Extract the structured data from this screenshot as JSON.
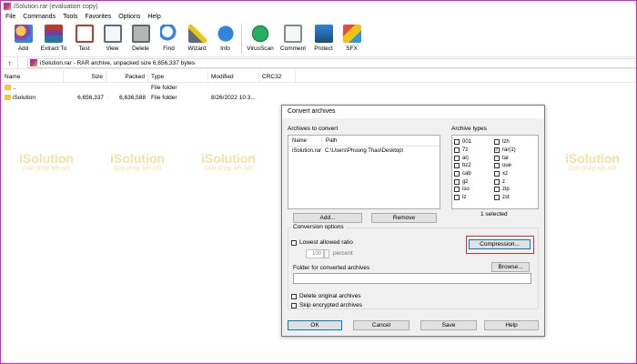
{
  "window": {
    "title": "iSolution.rar (evaluation copy)"
  },
  "menu": [
    "File",
    "Commands",
    "Tools",
    "Favorites",
    "Options",
    "Help"
  ],
  "toolbar": {
    "add": "Add",
    "extract": "Extract To",
    "test": "Test",
    "view": "View",
    "delete": "Delete",
    "find": "Find",
    "wizard": "Wizard",
    "info": "Info",
    "virusscan": "VirusScan",
    "comment": "Comment",
    "protect": "Protect",
    "sfx": "SFX"
  },
  "address": {
    "up": "↑",
    "path": "iSolution.rar - RAR archive, unpacked size 6,656,337 bytes"
  },
  "filelist": {
    "headers": {
      "name": "Name",
      "size": "Size",
      "packed": "Packed",
      "type": "Type",
      "modified": "Modified",
      "crc": "CRC32"
    },
    "rows": [
      {
        "name": "..",
        "size": "",
        "packed": "",
        "type": "File folder",
        "modified": "",
        "crc": ""
      },
      {
        "name": "iSolution",
        "size": "6,656,337",
        "packed": "6,636,588",
        "type": "File folder",
        "modified": "8/26/2022 10:3...",
        "crc": ""
      }
    ]
  },
  "watermark": {
    "title": "iSolution",
    "subtitle": "Giải pháp kết nối"
  },
  "dialog": {
    "title": "Convert archives",
    "archives_label": "Archives to convert",
    "archive_types_label": "Archive types",
    "col_name": "Name",
    "col_path": "Path",
    "archive_row": {
      "name": "iSolution.rar",
      "path": "C:\\Users\\Phuong Thao\\Desktop\\"
    },
    "types_left": [
      {
        "label": "001",
        "checked": false
      },
      {
        "label": "7z",
        "checked": false
      },
      {
        "label": "arj",
        "checked": false
      },
      {
        "label": "bz2",
        "checked": false
      },
      {
        "label": "cab",
        "checked": false
      },
      {
        "label": "gz",
        "checked": false
      },
      {
        "label": "iso",
        "checked": false
      },
      {
        "label": "lz",
        "checked": false
      }
    ],
    "types_right": [
      {
        "label": "lzh",
        "checked": false
      },
      {
        "label": "rar(1)",
        "checked": true
      },
      {
        "label": "tar",
        "checked": false
      },
      {
        "label": "uue",
        "checked": false
      },
      {
        "label": "xz",
        "checked": false
      },
      {
        "label": "z",
        "checked": false
      },
      {
        "label": "zip",
        "checked": false
      },
      {
        "label": "zst",
        "checked": false
      }
    ],
    "selected_count": "1 selected",
    "add_button": "Add...",
    "remove_button": "Remove",
    "conversion_options_label": "Conversion options",
    "lowest_ratio_label": "Lowest allowed ratio",
    "ratio_value": "100",
    "percent_label": "percent",
    "compression_button": "Compression...",
    "folder_label": "Folder for converted archives",
    "browse_button": "Browse...",
    "folder_value": "",
    "delete_original_label": "Delete original archives",
    "skip_encrypted_label": "Skip encrypted archives",
    "ok_button": "OK",
    "cancel_button": "Cancel",
    "save_button": "Save",
    "help_button": "Help"
  }
}
